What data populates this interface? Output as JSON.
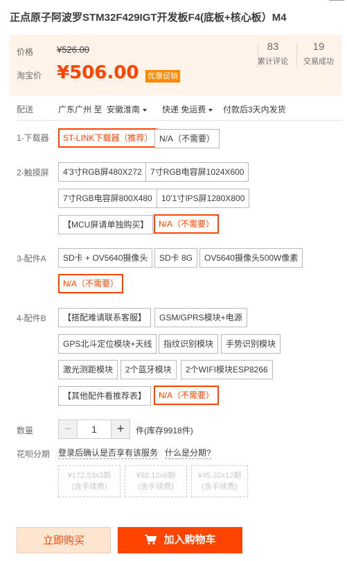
{
  "title": "正点原子阿波罗STM32F429IGT开发板F4(底板+核心板）M4",
  "price": {
    "label": "价格",
    "original": "¥526.00",
    "promo_label": "淘宝价",
    "promo": "¥506.00",
    "promo_badge": "优惠促销"
  },
  "stats": [
    {
      "num": "83",
      "label": "累计评论"
    },
    {
      "num": "19",
      "label": "交易成功"
    }
  ],
  "shipping": {
    "label": "配送",
    "from": "广东广州 至",
    "to": "安徽淮南",
    "method": "快递 免运费",
    "note": "付款后3天内发货"
  },
  "options": {
    "downloader": {
      "label": "1-下载器",
      "items": [
        "ST-LINK下载器（推荐）",
        "N/A（不需要）"
      ],
      "selected": 0
    },
    "touch": {
      "label": "2-触摸屏",
      "items": [
        "4'3寸RGB屏480X272",
        "7寸RGB电容屏1024X600",
        "7寸RGB电容屏800X480",
        "10'1寸IPS屏1280X800",
        "【MCU屏请单独购买】",
        "N/A（不需要）"
      ],
      "selected": 5
    },
    "partA": {
      "label": "3-配件A",
      "items": [
        "SD卡 + OV5640摄像头",
        "SD卡 8G",
        "OV5640摄像头500W像素",
        "N/A（不需要）"
      ],
      "selected": 3
    },
    "partB": {
      "label": "4-配件B",
      "items": [
        "【搭配难请联系客服】",
        "GSM/GPRS模块+电源",
        "GPS北斗定位模块+天线",
        "指纹识别模块",
        "手势识别模块",
        "激光测距模块",
        "2个蓝牙模块",
        "2个WIFI模块ESP8266",
        "【其他配件看推荐表】",
        "N/A（不需要）"
      ],
      "selected": 9
    }
  },
  "quantity": {
    "label": "数量",
    "value": "1",
    "minus": "−",
    "plus": "+",
    "stock": "件(库存9918件)"
  },
  "huabei": {
    "label": "花呗分期",
    "login_text": "登录后确认是否享有该服务",
    "what_text": "什么是分期?",
    "plans": [
      {
        "amount": "¥172.53x3期",
        "fee": "(含手续费)"
      },
      {
        "amount": "¥88.12x6期",
        "fee": "(含手续费)"
      },
      {
        "amount": "¥45.32x12期",
        "fee": "(含手续费)"
      }
    ]
  },
  "buttons": {
    "buy_now": "立即购买",
    "add_cart": "加入购物车"
  },
  "colors": {
    "accent": "#ff4400",
    "badge": "#ff8800",
    "price_bg": "#fff2e8"
  }
}
